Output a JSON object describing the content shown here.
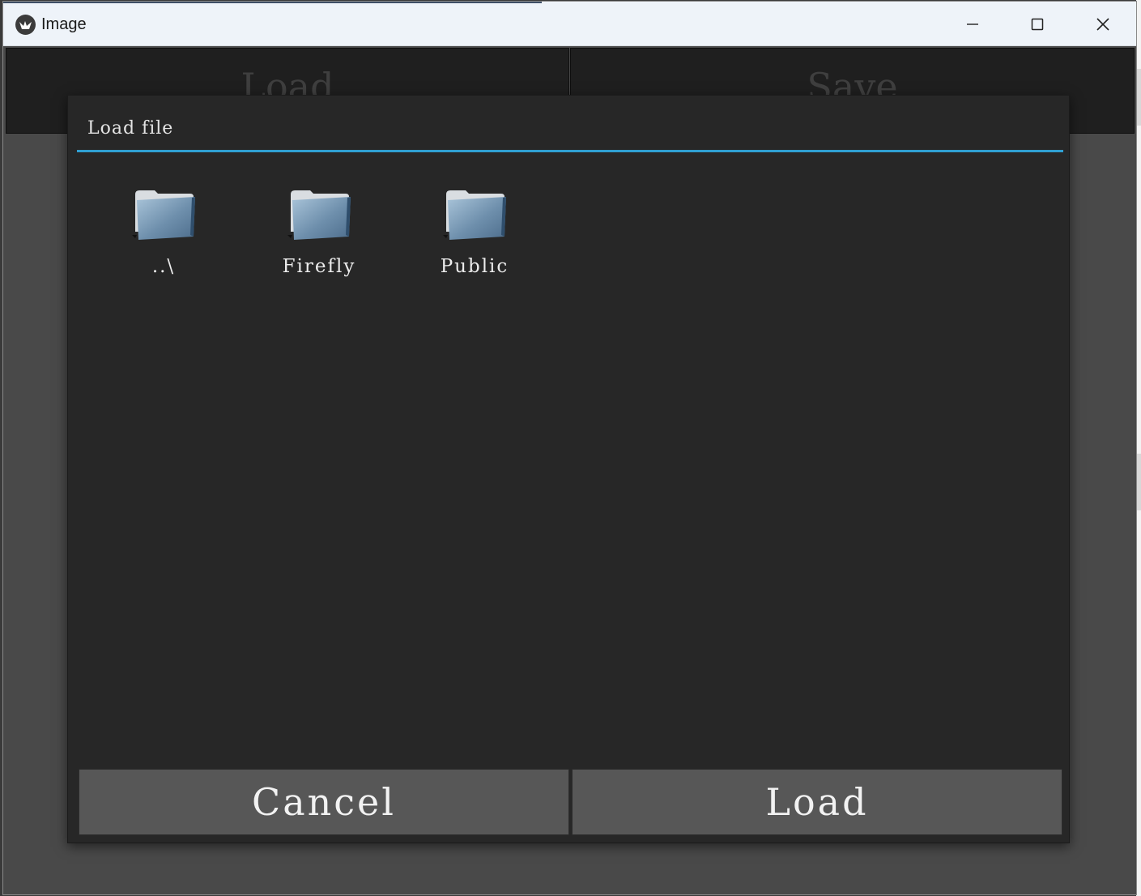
{
  "window": {
    "title": "Image",
    "controls": [
      "minimize-icon",
      "maximize-icon",
      "close-icon"
    ]
  },
  "top_buttons": {
    "load_label": "Load",
    "save_label": "Save"
  },
  "dialog": {
    "title": "Load file",
    "accent_color": "#2f9fd2",
    "files": [
      {
        "name": "..\\",
        "icon": "folder-icon"
      },
      {
        "name": "Firefly",
        "icon": "folder-icon"
      },
      {
        "name": "Public",
        "icon": "folder-icon"
      }
    ],
    "cancel_label": "Cancel",
    "load_label": "Load"
  }
}
